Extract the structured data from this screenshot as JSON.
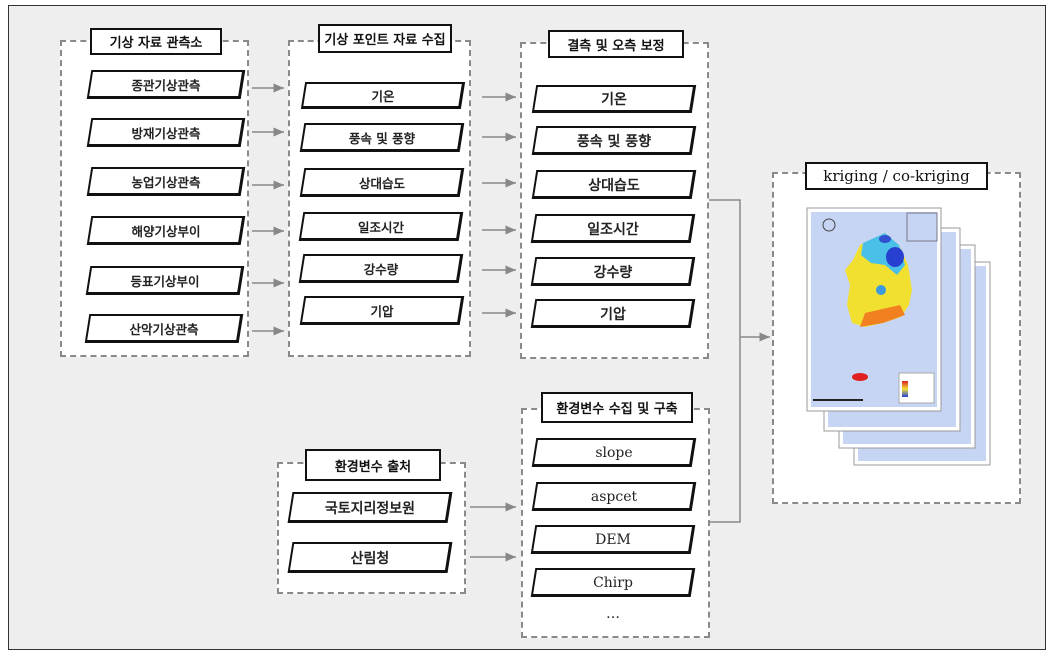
{
  "groups": {
    "stations": {
      "title": "기상 자료 관측소",
      "items": [
        "종관기상관측",
        "방재기상관측",
        "농업기상관측",
        "해양기상부이",
        "등표기상부이",
        "산악기상관측"
      ]
    },
    "point_collection": {
      "title": "기상 포인트 자료 수집",
      "items": [
        "기온",
        "풍속 및 풍향",
        "상대습도",
        "일조시간",
        "강수량",
        "기압"
      ]
    },
    "correction": {
      "title": "결측 및 오측 보정",
      "items": [
        "기온",
        "풍속 및 풍향",
        "상대습도",
        "일조시간",
        "강수량",
        "기압"
      ]
    },
    "kriging": {
      "title": "kriging / co-kriging"
    },
    "env_source": {
      "title": "환경변수 출처",
      "items": [
        "국토지리정보원",
        "산림청"
      ]
    },
    "env_build": {
      "title": "환경변수 수집 및 구축",
      "items": [
        "slope",
        "aspcet",
        "DEM",
        "Chirp"
      ],
      "more": "…"
    }
  },
  "colors": {
    "background": "#eeeeee",
    "dashed_border": "#8a8a8a",
    "arrow": "#888888",
    "map_sea": "#c7d5f5"
  }
}
